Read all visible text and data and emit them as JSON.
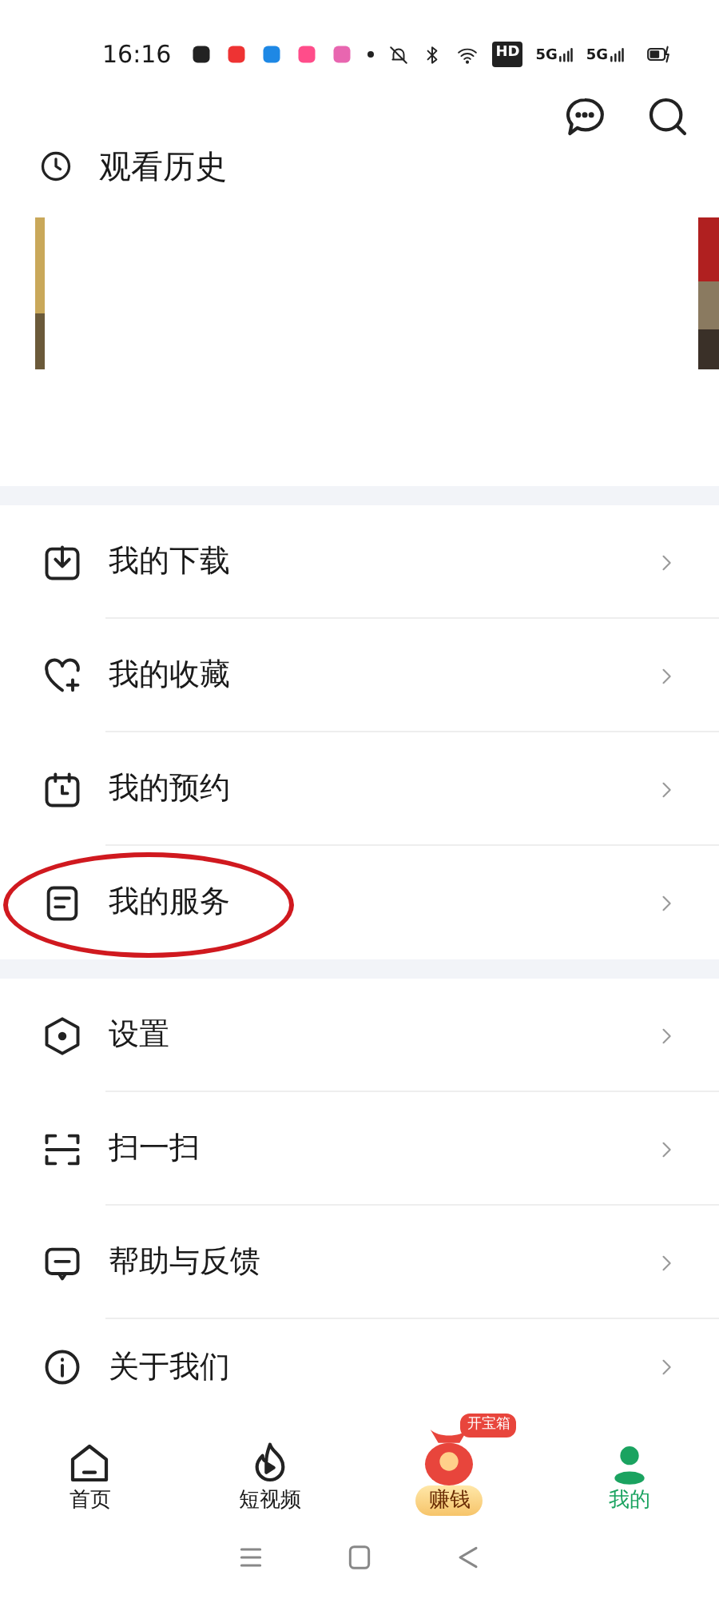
{
  "status_bar": {
    "time": "16:16",
    "hd": "HD",
    "signals": [
      "5G",
      "5G"
    ]
  },
  "history": {
    "title": "观看历史"
  },
  "menu_groups": [
    {
      "items": [
        {
          "label": "我的下载",
          "circled": false
        },
        {
          "label": "我的收藏",
          "circled": false
        },
        {
          "label": "我的预约",
          "circled": false
        },
        {
          "label": "我的服务",
          "circled": true
        }
      ]
    },
    {
      "items": [
        {
          "label": "设置",
          "circled": false
        },
        {
          "label": "扫一扫",
          "circled": false
        },
        {
          "label": "帮助与反馈",
          "circled": false
        },
        {
          "label": "关于我们",
          "circled": false
        }
      ]
    }
  ],
  "tabs": [
    {
      "kind": "plain",
      "label": "首页",
      "selected": false
    },
    {
      "kind": "plain",
      "label": "短视频",
      "selected": false
    },
    {
      "kind": "promo",
      "label": "赚钱",
      "badge": "开宝箱",
      "selected": false
    },
    {
      "kind": "plain",
      "label": "我的",
      "selected": true
    }
  ]
}
